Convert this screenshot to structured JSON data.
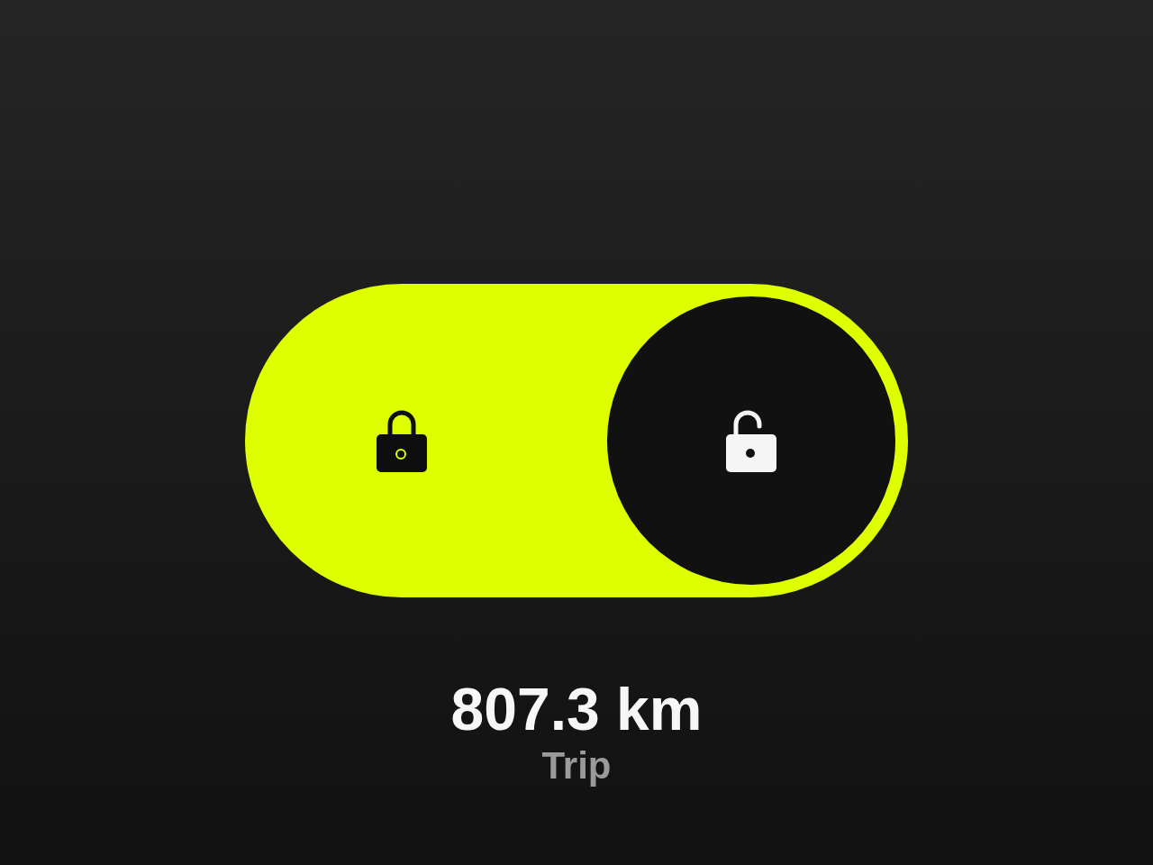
{
  "toggle": {
    "locked": false
  },
  "reading": {
    "value": "807.3 km",
    "label": "Trip"
  }
}
